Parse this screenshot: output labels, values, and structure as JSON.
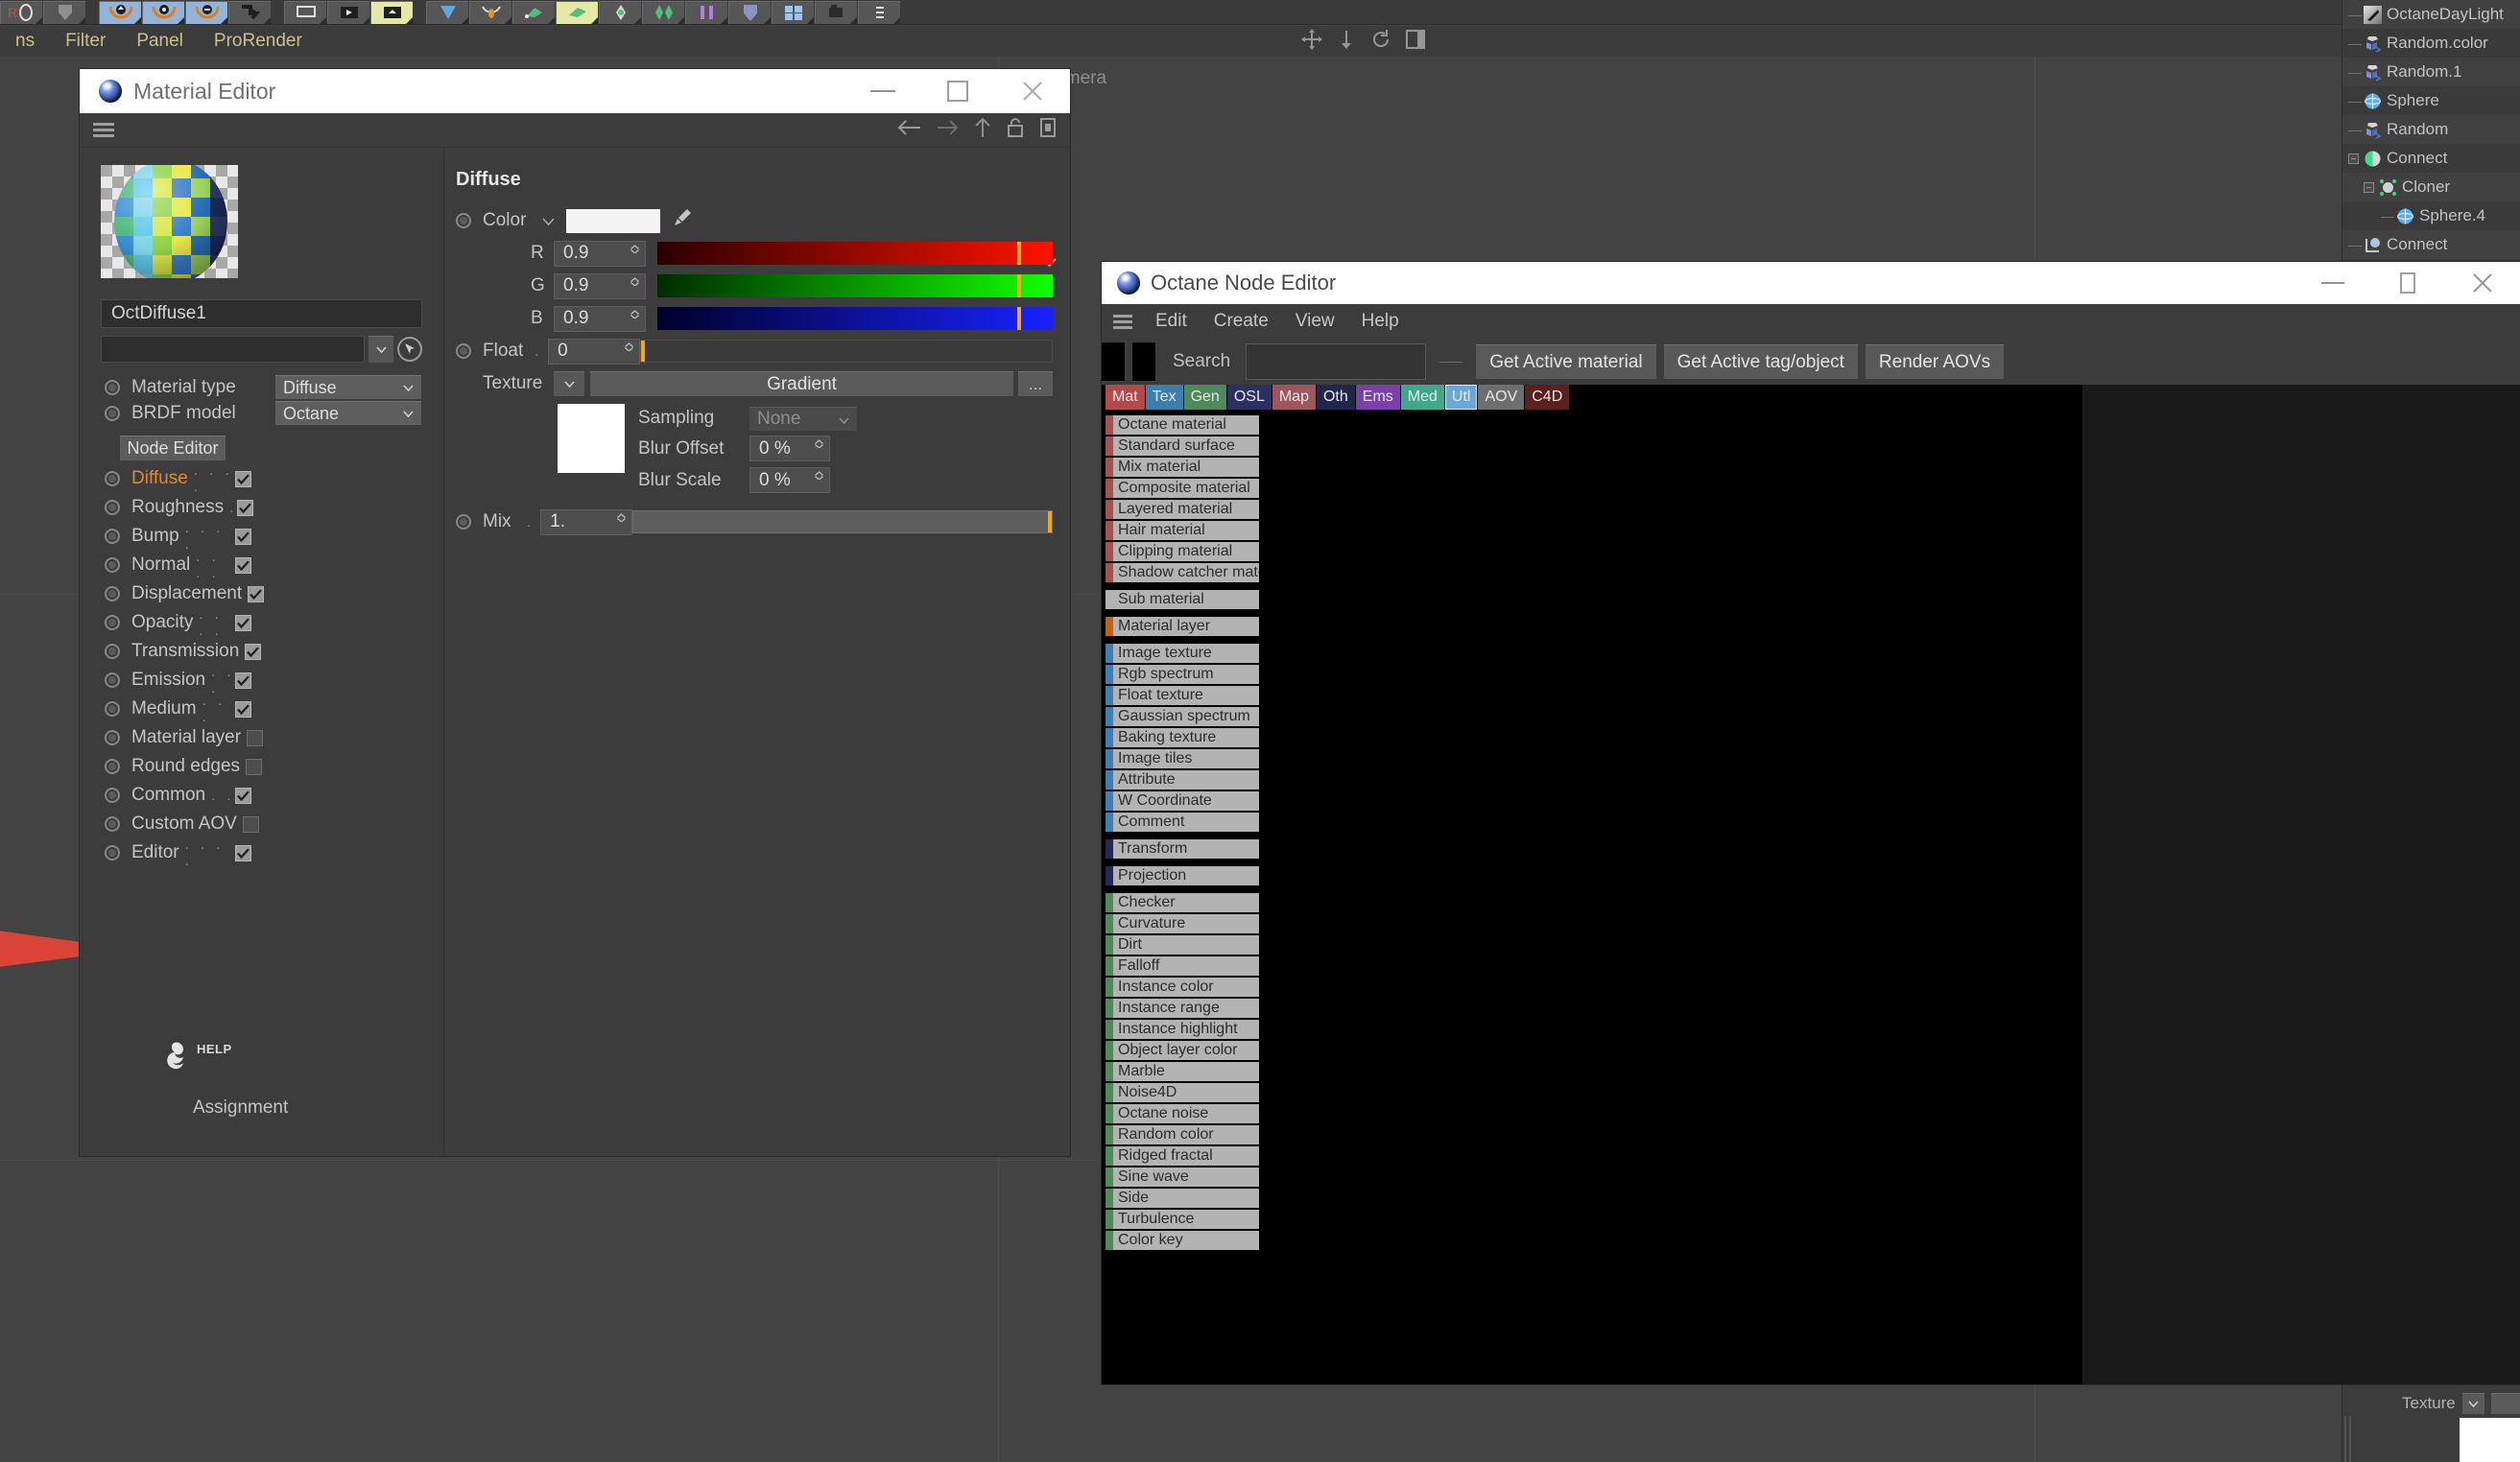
{
  "app": {
    "menubar": [
      {
        "label": "ns",
        "dim": false
      },
      {
        "label": "Filter",
        "dim": false
      },
      {
        "label": "Panel",
        "dim": false
      },
      {
        "label": "ProRender",
        "dim": false
      }
    ],
    "viewport_label": "Default Camera"
  },
  "object_manager": {
    "items": [
      {
        "label": "OctaneDayLight",
        "icon": "daylight-icon",
        "indent": 0,
        "expand": null
      },
      {
        "label": "Random.color",
        "icon": "random-effector-icon",
        "indent": 0,
        "expand": null
      },
      {
        "label": "Random.1",
        "icon": "random-effector-icon",
        "indent": 0,
        "expand": null
      },
      {
        "label": "Sphere",
        "icon": "sphere-icon",
        "indent": 0,
        "expand": null
      },
      {
        "label": "Random",
        "icon": "random-effector-icon",
        "indent": 0,
        "expand": null
      },
      {
        "label": "Connect",
        "icon": "connect-icon",
        "indent": 0,
        "expand": "minus"
      },
      {
        "label": "Cloner",
        "icon": "cloner-icon",
        "indent": 1,
        "expand": "minus"
      },
      {
        "label": "Sphere.4",
        "icon": "sphere-icon",
        "indent": 2,
        "expand": null
      },
      {
        "label": "Connect",
        "icon": "connect-object-icon",
        "indent": 0,
        "expand": null
      }
    ],
    "texture_label": "Texture"
  },
  "material_editor": {
    "title": "Material Editor",
    "window_buttons": [
      "minimize",
      "maximize",
      "close"
    ],
    "material_name": "OctDiffuse1",
    "link_field_value": "",
    "material_type": {
      "label": "Material type",
      "value": "Diffuse"
    },
    "brdf_model": {
      "label": "BRDF model",
      "value": "Octane"
    },
    "node_editor_button": "Node Editor",
    "attributes": [
      {
        "label": "Diffuse",
        "dots": ". . . .",
        "checked": true,
        "active": true
      },
      {
        "label": "Roughness",
        "dots": ".",
        "checked": true,
        "active": false
      },
      {
        "label": "Bump",
        "dots": ". . . .",
        "checked": true,
        "active": false
      },
      {
        "label": "Normal",
        "dots": ". . . .",
        "checked": true,
        "active": false
      },
      {
        "label": "Displacement",
        "dots": "",
        "checked": true,
        "active": false
      },
      {
        "label": "Opacity",
        "dots": ". . . .",
        "checked": true,
        "active": false
      },
      {
        "label": "Transmission",
        "dots": "",
        "checked": true,
        "active": false
      },
      {
        "label": "Emission",
        "dots": ". . .",
        "checked": true,
        "active": false
      },
      {
        "label": "Medium",
        "dots": ". . .",
        "checked": true,
        "active": false
      },
      {
        "label": "Material layer",
        "dots": "",
        "checked": false,
        "active": false
      },
      {
        "label": "Round edges",
        "dots": "",
        "checked": false,
        "active": false
      },
      {
        "label": "Common",
        "dots": ". .",
        "checked": true,
        "active": false
      },
      {
        "label": "Custom AOV",
        "dots": "",
        "checked": false,
        "active": false
      },
      {
        "label": "Editor",
        "dots": ". . . .",
        "checked": true,
        "active": false
      }
    ],
    "help_label": "HELP",
    "assignment_label": "Assignment",
    "diffuse_panel": {
      "title": "Diffuse",
      "color": {
        "label": "Color",
        "hex": "#f4f4f4"
      },
      "channels": [
        {
          "label": "R",
          "value": "0.9",
          "handle_pct": 91
        },
        {
          "label": "G",
          "value": "0.9",
          "handle_pct": 91
        },
        {
          "label": "B",
          "value": "0.9",
          "handle_pct": 91
        }
      ],
      "float": {
        "label": "Float",
        "dots": ".",
        "value": "0",
        "handle_pct": 0
      },
      "texture": {
        "label": "Texture",
        "value": "Gradient",
        "more": "..."
      },
      "sampling": {
        "label": "Sampling",
        "value": "None"
      },
      "blur_offset": {
        "label": "Blur Offset",
        "value": "0 %"
      },
      "blur_scale": {
        "label": "Blur Scale",
        "value": "0 %"
      },
      "mix": {
        "label": "Mix",
        "dots": ".",
        "value": "1.",
        "handle_pct": 100
      }
    }
  },
  "node_editor": {
    "title": "Octane Node Editor",
    "menus": [
      "Edit",
      "Create",
      "View",
      "Help"
    ],
    "search_label": "Search",
    "search_value": "",
    "buttons": [
      "Get Active material",
      "Get Active tag/object",
      "Render AOVs"
    ],
    "category_tabs": [
      {
        "label": "Mat",
        "color": "#b34a4a"
      },
      {
        "label": "Tex",
        "color": "#3d7fa8"
      },
      {
        "label": "Gen",
        "color": "#4f8a5c"
      },
      {
        "label": "OSL",
        "color": "#2c3060"
      },
      {
        "label": "Map",
        "color": "#9d5560"
      },
      {
        "label": "Oth",
        "color": "#22274a"
      },
      {
        "label": "Ems",
        "color": "#7b3fa8"
      },
      {
        "label": "Med",
        "color": "#3fa88b"
      },
      {
        "label": "Utl",
        "color": "#6aa8d8",
        "active": true
      },
      {
        "label": "AOV",
        "color": "#6e6e6e"
      },
      {
        "label": "C4D",
        "color": "#5c1f1f"
      }
    ],
    "node_groups": [
      {
        "bar_color": "#a4524f",
        "items": [
          "Octane material",
          "Standard surface",
          "Mix material",
          "Composite material",
          "Layered material",
          "Hair material",
          "Clipping material",
          "Shadow catcher material"
        ]
      },
      {
        "bar_color": "#b3b3b3",
        "items": [
          "Sub material"
        ]
      },
      {
        "bar_color": "#c2621a",
        "items": [
          "Material layer"
        ]
      },
      {
        "bar_color": "#3d7fb5",
        "items": [
          "Image texture",
          "Rgb spectrum",
          "Float texture",
          "Gaussian spectrum",
          "Baking texture",
          "Image tiles",
          "Attribute",
          "W Coordinate",
          "Comment"
        ]
      },
      {
        "bar_color": "#24295a",
        "items": [
          "Transform"
        ]
      },
      {
        "bar_color": "#24295a",
        "items": [
          "Projection"
        ]
      },
      {
        "bar_color": "#4f8a5c",
        "items": [
          "Checker",
          "Curvature",
          "Dirt",
          "Falloff",
          "Instance color",
          "Instance range",
          "Instance highlight",
          "Object layer color",
          "Marble",
          "Noise4D",
          "Octane noise",
          "Random color",
          "Ridged fractal",
          "Sine wave",
          "Side",
          "Turbulence",
          "Color key"
        ]
      }
    ]
  },
  "colors": {
    "app_bg": "#414141",
    "panel_bg": "#3c3c3c",
    "accent_orange": "#e08a33",
    "slider_handle": "#f5a623",
    "canvas_black": "#000000"
  }
}
